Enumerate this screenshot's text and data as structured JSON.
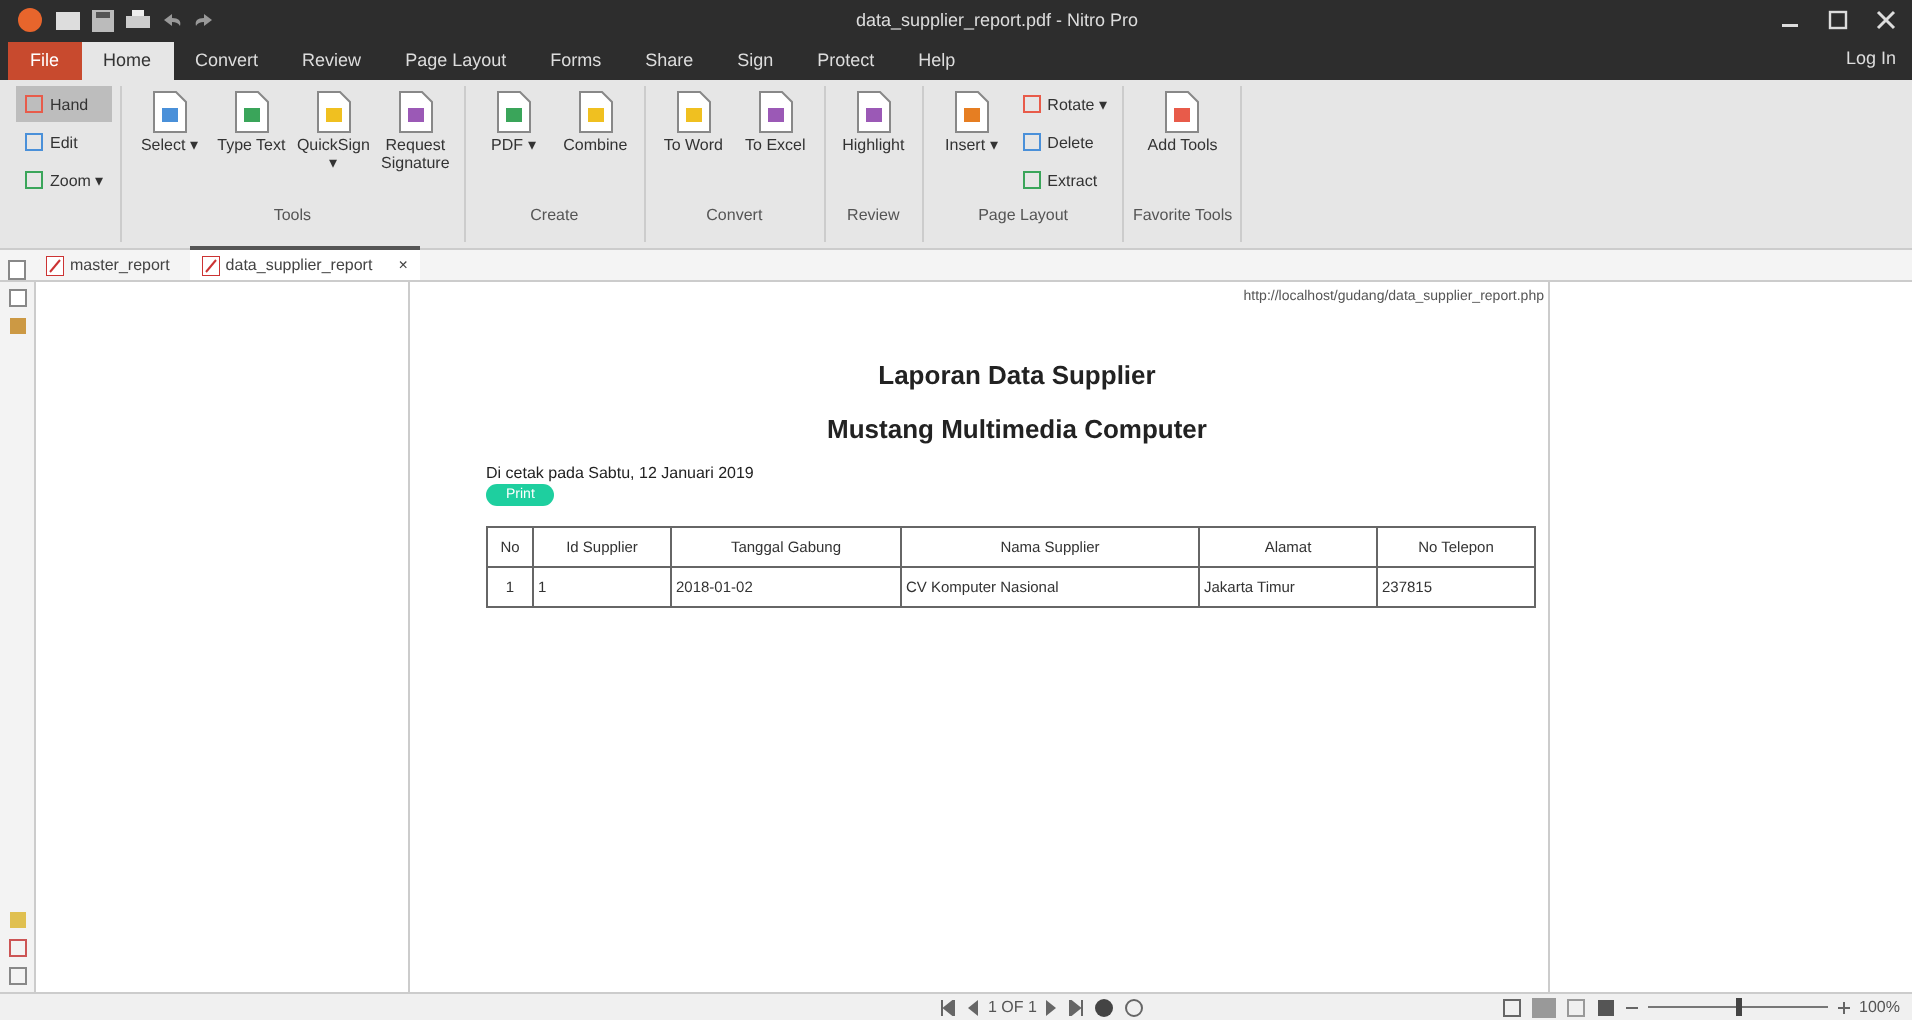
{
  "window": {
    "title": "data_supplier_report.pdf - Nitro Pro"
  },
  "menu_tabs": [
    {
      "label": "File",
      "selected": false,
      "kind": "file"
    },
    {
      "label": "Home",
      "selected": true,
      "kind": "tab"
    },
    {
      "label": "Convert",
      "selected": false,
      "kind": "tab"
    },
    {
      "label": "Review",
      "selected": false,
      "kind": "tab"
    },
    {
      "label": "Page Layout",
      "selected": false,
      "kind": "tab"
    },
    {
      "label": "Forms",
      "selected": false,
      "kind": "tab"
    },
    {
      "label": "Share",
      "selected": false,
      "kind": "tab"
    },
    {
      "label": "Sign",
      "selected": false,
      "kind": "tab"
    },
    {
      "label": "Protect",
      "selected": false,
      "kind": "tab"
    },
    {
      "label": "Help",
      "selected": false,
      "kind": "tab"
    }
  ],
  "login": "Log In",
  "ribbon": [
    {
      "items": [
        {
          "label": "Hand",
          "kind": "small",
          "selected": true
        },
        {
          "label": "Edit",
          "kind": "small",
          "selected": false
        },
        {
          "label": "Zoom ▾",
          "kind": "small",
          "selected": false
        }
      ]
    },
    {
      "label": "Tools",
      "items": [
        {
          "label": "Select ▾",
          "kind": "large"
        },
        {
          "label": "Type Text",
          "kind": "large"
        },
        {
          "label": "QuickSign ▾",
          "kind": "large"
        },
        {
          "label": "Request Signature",
          "kind": "large"
        }
      ]
    },
    {
      "label": "Create",
      "items": [
        {
          "label": "PDF ▾",
          "kind": "large"
        },
        {
          "label": "Combine",
          "kind": "large"
        }
      ]
    },
    {
      "label": "Convert",
      "items": [
        {
          "label": "To Word",
          "kind": "large"
        },
        {
          "label": "To Excel",
          "kind": "large"
        }
      ]
    },
    {
      "label": "Review",
      "items": [
        {
          "label": "Highlight",
          "kind": "large"
        }
      ]
    },
    {
      "label": "Page Layout",
      "items": [
        {
          "label": "Insert ▾",
          "kind": "large"
        },
        {
          "label": "Rotate ▾",
          "kind": "small",
          "selected": false
        },
        {
          "label": "Delete",
          "kind": "small",
          "selected": false
        },
        {
          "label": "Extract",
          "kind": "small",
          "selected": false
        }
      ]
    },
    {
      "label": "Favorite Tools",
      "items": [
        {
          "label": "Add Tools",
          "kind": "large"
        }
      ]
    }
  ],
  "doc_tabs": [
    {
      "label": "master_report",
      "selected": false
    },
    {
      "label": "data_supplier_report",
      "selected": true,
      "close": "×"
    }
  ],
  "document": {
    "url": "http://localhost/gudang/data_supplier_report.php",
    "title": "Laporan Data Supplier",
    "subtitle": "Mustang Multimedia Computer",
    "printed_on": "Di cetak pada Sabtu, 12 Januari 2019",
    "print_button": "Print",
    "table": {
      "columns": [
        "No",
        "Id Supplier",
        "Tanggal Gabung",
        "Nama Supplier",
        "Alamat",
        "No Telepon"
      ],
      "rows": [
        [
          "1",
          "1",
          "2018-01-02",
          "CV Komputer Nasional",
          "Jakarta Timur",
          "237815"
        ]
      ]
    }
  },
  "status_bar": {
    "page": "1 OF 1",
    "zoom": "100%",
    "zoom_slider": {
      "level": 0.5
    }
  }
}
